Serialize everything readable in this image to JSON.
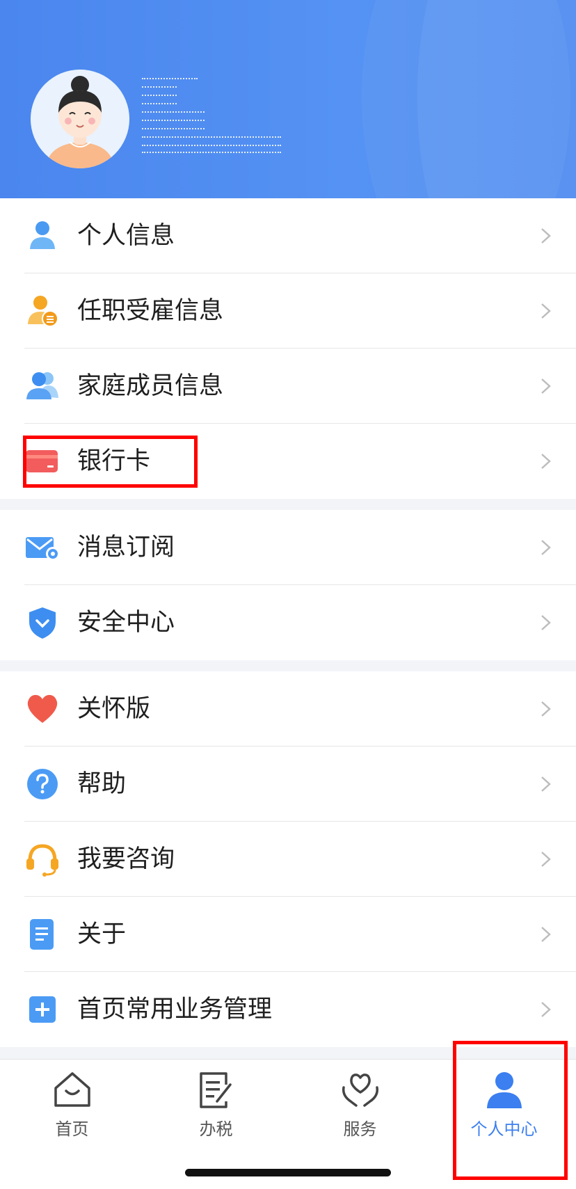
{
  "menu_groups": [
    {
      "items": [
        {
          "label": "个人信息",
          "icon": "person-icon"
        },
        {
          "label": "任职受雇信息",
          "icon": "employment-icon"
        },
        {
          "label": "家庭成员信息",
          "icon": "family-icon"
        },
        {
          "label": "银行卡",
          "icon": "bank-card-icon"
        }
      ]
    },
    {
      "items": [
        {
          "label": "消息订阅",
          "icon": "message-subscribe-icon"
        },
        {
          "label": "安全中心",
          "icon": "shield-icon"
        }
      ]
    },
    {
      "items": [
        {
          "label": "关怀版",
          "icon": "heart-icon"
        },
        {
          "label": "帮助",
          "icon": "help-icon"
        },
        {
          "label": "我要咨询",
          "icon": "headset-icon"
        },
        {
          "label": "关于",
          "icon": "document-icon"
        },
        {
          "label": "首页常用业务管理",
          "icon": "plus-square-icon"
        }
      ]
    }
  ],
  "tabbar": {
    "tabs": [
      {
        "label": "首页",
        "icon": "home-icon",
        "active": false
      },
      {
        "label": "办税",
        "icon": "tax-form-icon",
        "active": false
      },
      {
        "label": "服务",
        "icon": "service-heart-icon",
        "active": false
      },
      {
        "label": "个人中心",
        "icon": "user-center-icon",
        "active": true
      }
    ]
  },
  "colors": {
    "header_blue": "#4a86ee",
    "accent_blue": "#3b7ff0",
    "highlight_red": "#ff0000",
    "divider": "#e6e6e6"
  }
}
